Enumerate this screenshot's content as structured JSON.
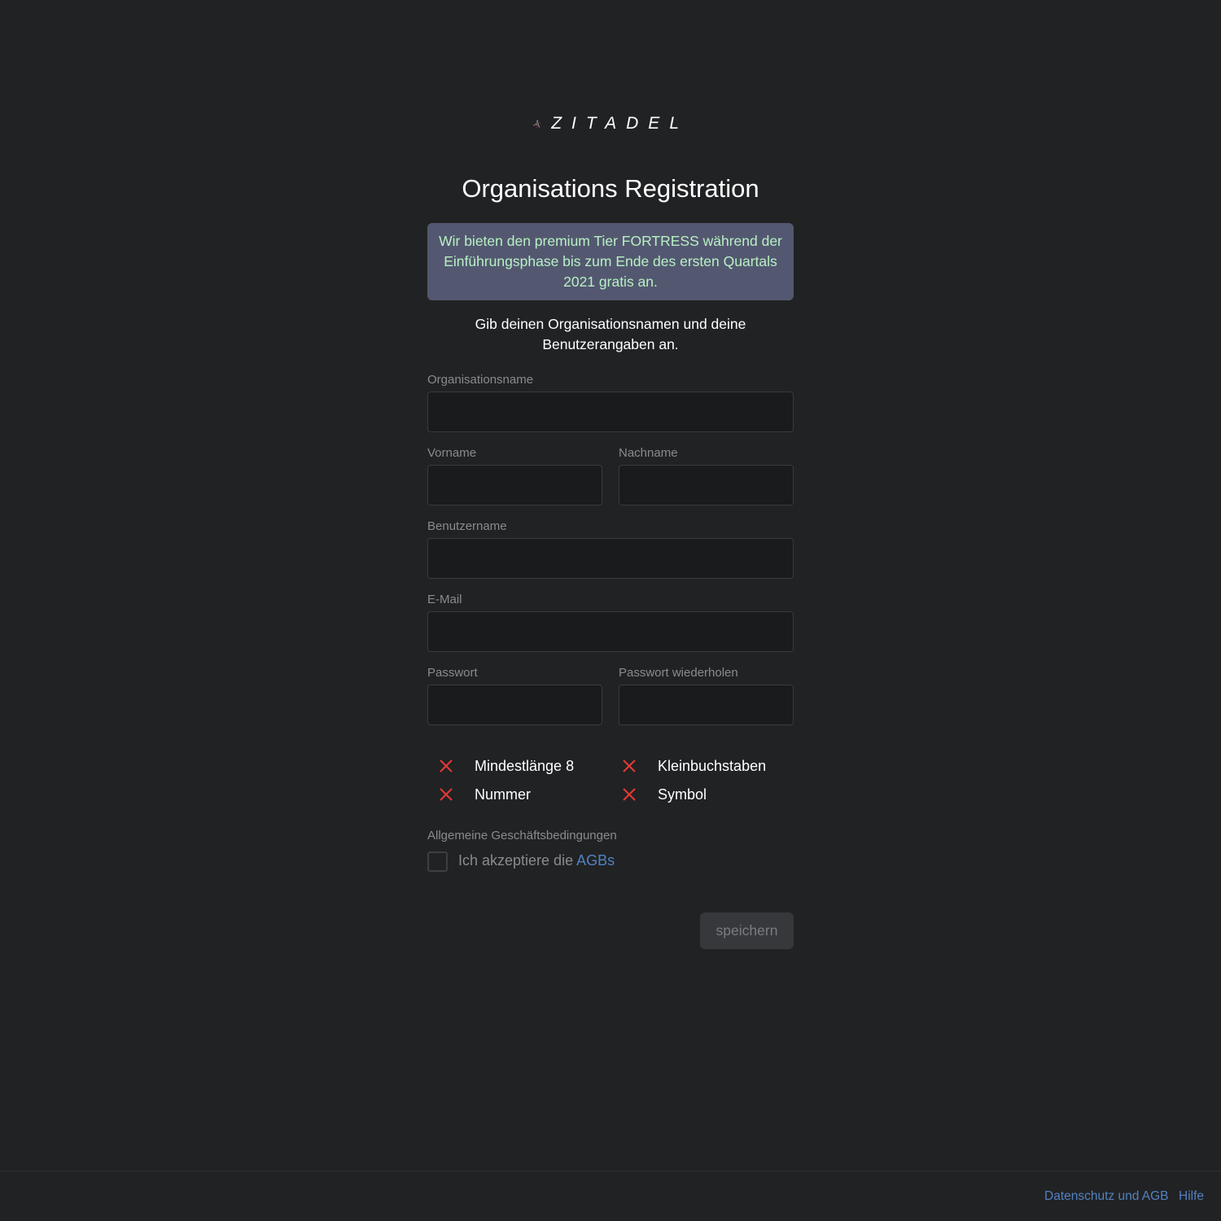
{
  "brand": {
    "name": "ZITADEL",
    "logo_icon": "zitadel-triangle-logo"
  },
  "header": {
    "title": "Organisations Registration"
  },
  "info": {
    "text": "Wir bieten den premium Tier FORTRESS während der Einführungsphase bis zum Ende des ersten Quartals 2021 gratis an."
  },
  "instruction": {
    "text": "Gib deinen Organisationsnamen und deine Benutzerangaben an."
  },
  "form": {
    "org_name_label": "Organisationsname",
    "org_name_value": "",
    "first_name_label": "Vorname",
    "first_name_value": "",
    "last_name_label": "Nachname",
    "last_name_value": "",
    "username_label": "Benutzername",
    "username_value": "",
    "email_label": "E-Mail",
    "email_value": "",
    "password_label": "Passwort",
    "password_value": "",
    "password_repeat_label": "Passwort wiederholen",
    "password_repeat_value": ""
  },
  "password_requirements": [
    {
      "label": "Mindestlänge 8",
      "met": false,
      "icon": "x-icon"
    },
    {
      "label": "Kleinbuchstaben",
      "met": false,
      "icon": "x-icon"
    },
    {
      "label": "Nummer",
      "met": false,
      "icon": "x-icon"
    },
    {
      "label": "Symbol",
      "met": false,
      "icon": "x-icon"
    }
  ],
  "terms": {
    "section_label": "Allgemeine Geschäftsbedingungen",
    "accept_prefix": "Ich akzeptiere die",
    "accept_link": "AGBs",
    "checked": false
  },
  "actions": {
    "save_label": "speichern"
  },
  "footer": {
    "privacy_link": "Datenschutz und AGB",
    "help_link": "Hilfe"
  },
  "colors": {
    "background": "#212224",
    "info_background": "#535870",
    "info_text": "#b8f0c4",
    "link": "#5282c1",
    "error_icon": "#e53935"
  }
}
